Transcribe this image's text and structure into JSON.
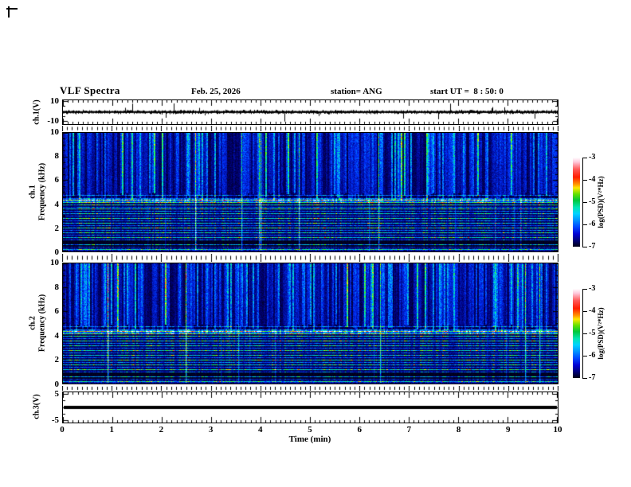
{
  "header": {
    "title": "VLF Spectra",
    "date": "Feb. 25, 2026",
    "station": "station= ANG",
    "start_ut": "start UT =  8 : 50: 0"
  },
  "panels": {
    "waveform": {
      "label": "ch.1(V)",
      "y_ticks": [
        "10",
        "-10"
      ]
    },
    "spec1": {
      "channel": "ch.1",
      "axis_label": "Frequency (kHz)",
      "y_ticks": [
        "10",
        "8",
        "6",
        "4",
        "2",
        "0"
      ]
    },
    "spec2": {
      "channel": "ch.2",
      "axis_label": "Frequency (kHz)",
      "y_ticks": [
        "10",
        "8",
        "6",
        "4",
        "2",
        "0"
      ]
    },
    "ch3": {
      "label": "ch.3(V)",
      "y_ticks": [
        "5",
        "-5"
      ]
    }
  },
  "xaxis": {
    "label": "Time (min)",
    "ticks": [
      "0",
      "1",
      "2",
      "3",
      "4",
      "5",
      "6",
      "7",
      "8",
      "9",
      "10"
    ]
  },
  "colorbars": [
    {
      "label": "log(PSD)(V²*Hz)",
      "ticks": [
        "-3",
        "-4",
        "-5",
        "-6",
        "-7"
      ]
    },
    {
      "label": "log(PSD)(V²*Hz)",
      "ticks": [
        "-3",
        "-4",
        "-5",
        "-6",
        "-7"
      ]
    }
  ],
  "chart_data": {
    "type": "heatmap",
    "title": "VLF Spectra",
    "subtitle": "Feb. 25, 2026  station= ANG  start UT = 8:50:0",
    "x": {
      "label": "Time (min)",
      "min": 0,
      "max": 10,
      "major_tick": 1,
      "minor_tick": 0.1
    },
    "panels": [
      {
        "id": "ch1_wave",
        "type": "line",
        "ylabel": "ch.1(V)",
        "ylim": [
          -10,
          10
        ],
        "signal": "continuous broadband noise about 0 V, envelope near ±1.5 V, sporadic impulses to about ±6 V",
        "seed": 11
      },
      {
        "id": "ch1_spec",
        "type": "spectrogram",
        "ylabel": "Frequency (kHz)",
        "ylim": [
          0,
          10
        ],
        "colorbar_label": "log(PSD)(V²*Hz)",
        "clim": [
          -7,
          -3
        ],
        "seed": 101
      },
      {
        "id": "ch2_spec",
        "type": "spectrogram",
        "ylabel": "Frequency (kHz)",
        "ylim": [
          0,
          10
        ],
        "colorbar_label": "log(PSD)(V²*Hz)",
        "clim": [
          -7,
          -3
        ],
        "seed": 202
      },
      {
        "id": "ch3_wave",
        "type": "line",
        "ylabel": "ch.3(V)",
        "ylim": [
          -5,
          5
        ],
        "signal": "flat thick trace at 0 V",
        "value": 0
      }
    ],
    "colormap": [
      [
        0,
        "#000000"
      ],
      [
        0.13,
        "#000078"
      ],
      [
        0.3,
        "#0032ff"
      ],
      [
        0.45,
        "#00b4ff"
      ],
      [
        0.57,
        "#00ff96"
      ],
      [
        0.66,
        "#46ff00"
      ],
      [
        0.76,
        "#ffff00"
      ],
      [
        0.87,
        "#ff2800"
      ],
      [
        1,
        "#ffffff"
      ]
    ],
    "spectrogram_features": {
      "description": "dense vertical sferic streaks above ~4.6 kHz with occasional full-band bright streaks; quasi-horizontal hum/tweek lines below ~4.8 kHz; bright band 4.1-4.5 kHz; dark band 0.25-0.95 kHz; bright speckle below 0.25 kHz",
      "band": {
        "f_lo": 4.1,
        "f_hi": 4.52
      },
      "dark_band": {
        "f_lo": 0.25,
        "f_hi": 0.95
      },
      "hum_lines": [
        [
          4.75,
          0.3
        ],
        [
          4.35,
          0.62
        ],
        [
          4.15,
          0.4
        ],
        [
          3.95,
          0.55
        ],
        [
          3.75,
          0.3
        ],
        [
          3.55,
          0.58
        ],
        [
          3.35,
          0.33
        ],
        [
          3.15,
          0.5
        ],
        [
          2.95,
          0.3
        ],
        [
          2.75,
          0.58
        ],
        [
          2.55,
          0.33
        ],
        [
          2.35,
          0.52
        ],
        [
          2.15,
          0.3
        ],
        [
          1.95,
          0.58
        ],
        [
          1.75,
          0.33
        ],
        [
          1.55,
          0.52
        ],
        [
          1.35,
          0.3
        ],
        [
          1.15,
          0.58
        ],
        [
          0.95,
          0.4
        ],
        [
          0.55,
          0.5
        ],
        [
          0.35,
          0.3
        ],
        [
          0.15,
          0.45
        ]
      ]
    }
  }
}
